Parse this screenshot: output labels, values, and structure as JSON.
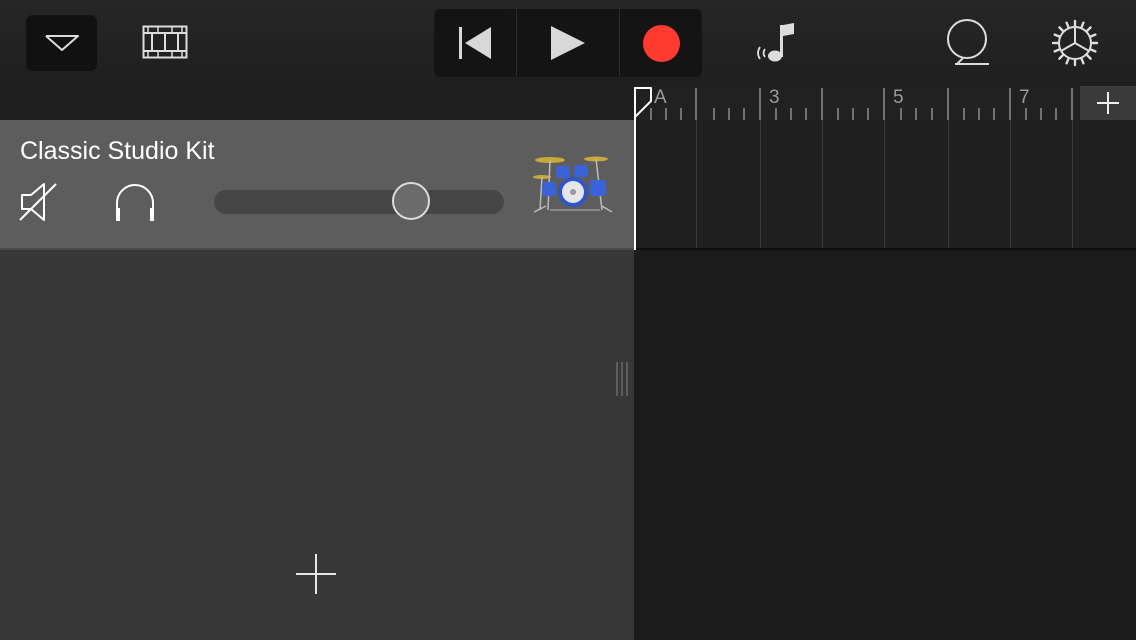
{
  "toolbar": {
    "browser_icon": "chevron-down-icon",
    "tracks_view_icon": "film-strip-icon",
    "transport": {
      "rewind_icon": "skip-back-icon",
      "play_icon": "play-icon",
      "record_icon": "record-icon"
    },
    "metronome_icon": "metronome-note-icon",
    "loop_icon": "loop-lasso-icon",
    "settings_icon": "gear-icon"
  },
  "track": {
    "name": "Classic Studio Kit",
    "mute_icon": "speaker-muted-icon",
    "solo_icon": "headphones-icon",
    "volume": 0.68,
    "instrument_icon": "drum-kit-icon"
  },
  "ruler": {
    "marker_label": "A",
    "bar_labels": [
      "3",
      "5",
      "7"
    ],
    "add_section_icon": "plus-icon"
  },
  "colors": {
    "record": "#ff3b30",
    "track_header": "#5d5d5d",
    "toolbar": "#262626"
  }
}
